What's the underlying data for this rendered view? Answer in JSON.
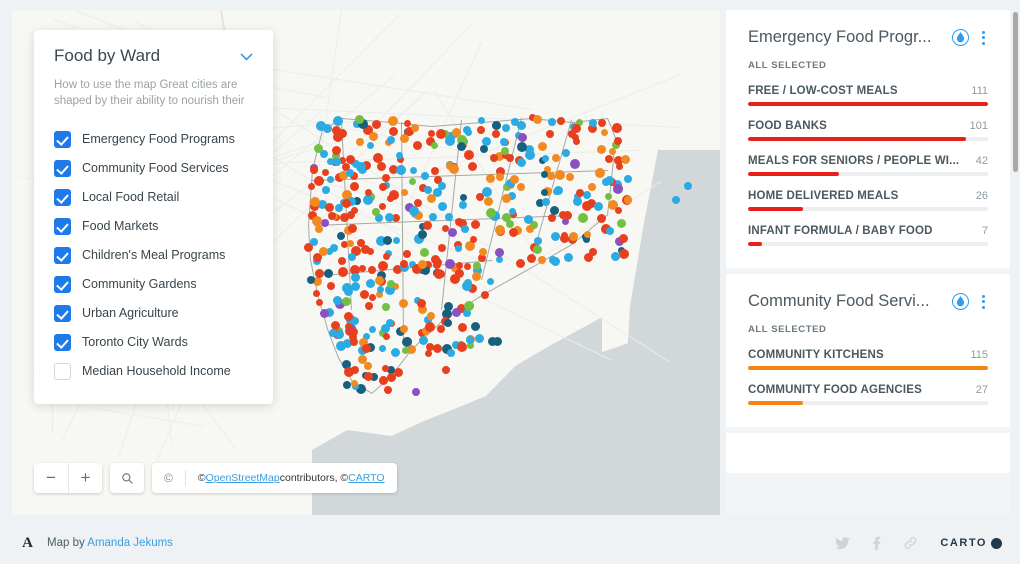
{
  "legend": {
    "title": "Food by Ward",
    "chevron_icon": "chevron-down-icon",
    "description": "How to use the map Great cities are shaped by their ability to nourish their",
    "items": [
      {
        "label": "Emergency Food Programs",
        "checked": true
      },
      {
        "label": "Community Food Services",
        "checked": true
      },
      {
        "label": "Local Food Retail",
        "checked": true
      },
      {
        "label": "Food Markets",
        "checked": true
      },
      {
        "label": "Children's Meal Programs",
        "checked": true
      },
      {
        "label": "Community Gardens",
        "checked": true
      },
      {
        "label": "Urban Agriculture",
        "checked": true
      },
      {
        "label": "Toronto City Wards",
        "checked": true
      },
      {
        "label": "Median Household Income",
        "checked": false
      }
    ]
  },
  "map": {
    "zoom_out_label": "−",
    "zoom_in_label": "+",
    "search_icon": "search-icon",
    "attribution": {
      "copyright_mark": "©",
      "prefix": "© ",
      "osm_label": "OpenStreetMap",
      "middle": " contributors, © ",
      "carto_label": "CARTO"
    },
    "colors": {
      "land": "#f7f7f4",
      "water": "#d2d8da",
      "dot_red": "#e8401e",
      "dot_blue": "#2babe2",
      "dot_orange": "#f18a21",
      "dot_green": "#72c043",
      "dot_purple": "#8a4fc0",
      "dot_teal": "#17607f"
    }
  },
  "panel": {
    "widgets": [
      {
        "title": "Emergency Food Progr...",
        "icon": "water-drop-icon",
        "menu_icon": "kebab-menu-icon",
        "subtitle": "ALL SELECTED",
        "bar_color": "#e8201a",
        "max": 111,
        "categories": [
          {
            "name": "FREE / LOW-COST MEALS",
            "value": 111
          },
          {
            "name": "FOOD BANKS",
            "value": 101
          },
          {
            "name": "MEALS FOR SENIORS / PEOPLE WI...",
            "value": 42
          },
          {
            "name": "HOME DELIVERED MEALS",
            "value": 26
          },
          {
            "name": "INFANT FORMULA / BABY FOOD",
            "value": 7
          }
        ]
      },
      {
        "title": "Community Food Servi...",
        "icon": "water-drop-icon",
        "menu_icon": "kebab-menu-icon",
        "subtitle": "ALL SELECTED",
        "bar_color": "#f58410",
        "max": 115,
        "categories": [
          {
            "name": "COMMUNITY KITCHENS",
            "value": 115
          },
          {
            "name": "COMMUNITY FOOD AGENCIES",
            "value": 27
          }
        ]
      }
    ]
  },
  "footer": {
    "avatar_letter": "A",
    "map_by_prefix": "Map by ",
    "author_name": "Amanda Jekums",
    "twitter_icon": "twitter-icon",
    "facebook_icon": "facebook-icon",
    "link_icon": "link-icon",
    "brand": "CARTO"
  },
  "chart_data": [
    {
      "type": "bar",
      "title": "Emergency Food Progr...",
      "categories": [
        "FREE / LOW-COST MEALS",
        "FOOD BANKS",
        "MEALS FOR SENIORS / PEOPLE WI...",
        "HOME DELIVERED MEALS",
        "INFANT FORMULA / BABY FOOD"
      ],
      "values": [
        111,
        101,
        42,
        26,
        7
      ],
      "xlabel": "",
      "ylabel": "",
      "ylim": [
        0,
        111
      ],
      "orientation": "horizontal",
      "grid": false,
      "legend": "none",
      "color": "#e8201a"
    },
    {
      "type": "bar",
      "title": "Community Food Servi...",
      "categories": [
        "COMMUNITY KITCHENS",
        "COMMUNITY FOOD AGENCIES"
      ],
      "values": [
        115,
        27
      ],
      "xlabel": "",
      "ylabel": "",
      "ylim": [
        0,
        115
      ],
      "orientation": "horizontal",
      "grid": false,
      "legend": "none",
      "color": "#f58410"
    }
  ]
}
